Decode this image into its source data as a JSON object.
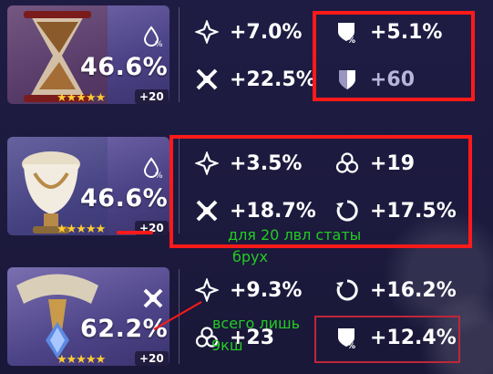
{
  "cards": [
    {
      "main_value": "46.6%",
      "stars": "★★★★★",
      "level": "+20",
      "subs": [
        "+7.0%",
        "+5.1%",
        "+22.5%",
        "+60"
      ]
    },
    {
      "main_value": "46.6%",
      "stars": "★★★★★",
      "level": "+20",
      "subs": [
        "+3.5%",
        "+19",
        "+18.7%",
        "+17.5%"
      ]
    },
    {
      "main_value": "62.2%",
      "stars": "★★★★★",
      "level": "+20",
      "subs": [
        "+9.3%",
        "+16.2%",
        "+23",
        "+12.4%"
      ]
    }
  ],
  "annotations": {
    "note_1_line_1": "для 20 лвл статы",
    "note_1_line_2": "брух",
    "note_2_line_1": "всего лишь",
    "note_2_line_2": "9кш"
  },
  "icons": {
    "hydro_dmg": "water-drop-percent-icon",
    "crit_rate": "crit-rate-icon",
    "crit_dmg": "crit-dmg-icon",
    "def_percent": "shield-percent-icon",
    "def_flat": "shield-icon",
    "elemental_mastery": "elemental-mastery-icon",
    "energy_recharge": "energy-recharge-icon",
    "dendro_dmg": "crit-cross-icon"
  },
  "colors": {
    "highlight_red": "#ff1a1a",
    "annotation_green": "#22cc22",
    "stars": "#ffcc33"
  }
}
